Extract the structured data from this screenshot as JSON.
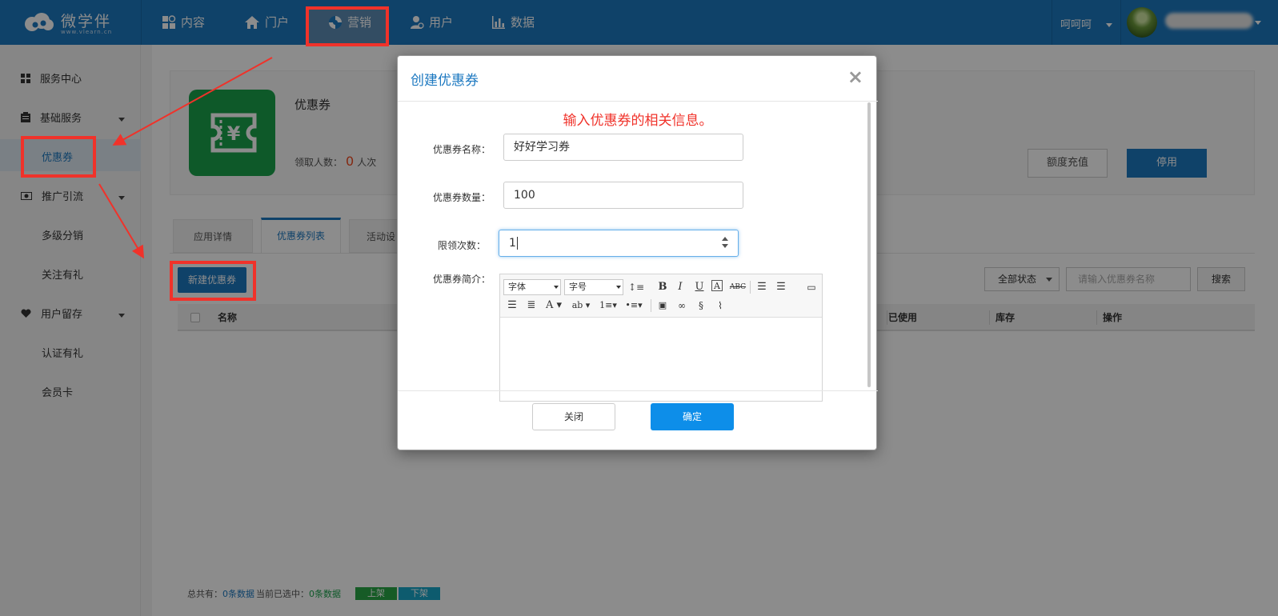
{
  "app": {
    "logo_name": "微学伴",
    "logo_url": "www.vlearn.cn"
  },
  "topnav": [
    {
      "label": "内容",
      "icon": "content-icon"
    },
    {
      "label": "门户",
      "icon": "home-icon"
    },
    {
      "label": "营销",
      "icon": "marketing-icon",
      "active": true
    },
    {
      "label": "用户",
      "icon": "user-icon"
    },
    {
      "label": "数据",
      "icon": "bar-chart-icon"
    }
  ],
  "user": {
    "name": "呵呵呵"
  },
  "sidebar": {
    "items": [
      {
        "label": "服务中心",
        "icon": "grid-icon"
      },
      {
        "label": "基础服务",
        "icon": "clipboard-icon"
      },
      {
        "label": "优惠券",
        "active": true
      },
      {
        "label": "推广引流",
        "icon": "money-icon"
      },
      {
        "label": "多级分销"
      },
      {
        "label": "关注有礼"
      },
      {
        "label": "用户留存",
        "icon": "heart-icon"
      },
      {
        "label": "认证有礼"
      },
      {
        "label": "会员卡"
      }
    ]
  },
  "card": {
    "title": "优惠券",
    "stat_prefix": "领取人数：",
    "stat_value": "0",
    "stat_unit": "人次",
    "recharge_label": "额度充值",
    "disable_label": "停用"
  },
  "tabs": [
    "应用详情",
    "优惠券列表",
    "活动设"
  ],
  "toolbar": {
    "new_label": "新建优惠券",
    "status_select": "全部状态",
    "search_placeholder": "请输入优惠券名称",
    "search_label": "搜索"
  },
  "table": {
    "headers": [
      "名称",
      "已使用",
      "库存",
      "操作"
    ]
  },
  "footer": {
    "total_prefix": "总共有：",
    "total_value": "0条数据",
    "selected_prefix": "当前已选中：",
    "selected_value": "0条数据",
    "up_label": "上架",
    "down_label": "下架"
  },
  "modal": {
    "title": "创建优惠券",
    "close_glyph": "×",
    "tip": "输入优惠券的相关信息。",
    "fields": {
      "name_label": "优惠券名称：",
      "name_value": "好好学习券",
      "count_label": "优惠券数量：",
      "count_value": "100",
      "limit_label": "限领次数：",
      "limit_value": "1",
      "intro_label": "优惠券简介："
    },
    "editor": {
      "font_family": "字体",
      "font_size": "字号"
    },
    "close_label": "关闭",
    "confirm_label": "确定"
  },
  "colors": {
    "brand": "#1c78c0",
    "annotation": "#f0322a",
    "confirm": "#0d8ee9",
    "coupon_green": "#1aa24c"
  }
}
